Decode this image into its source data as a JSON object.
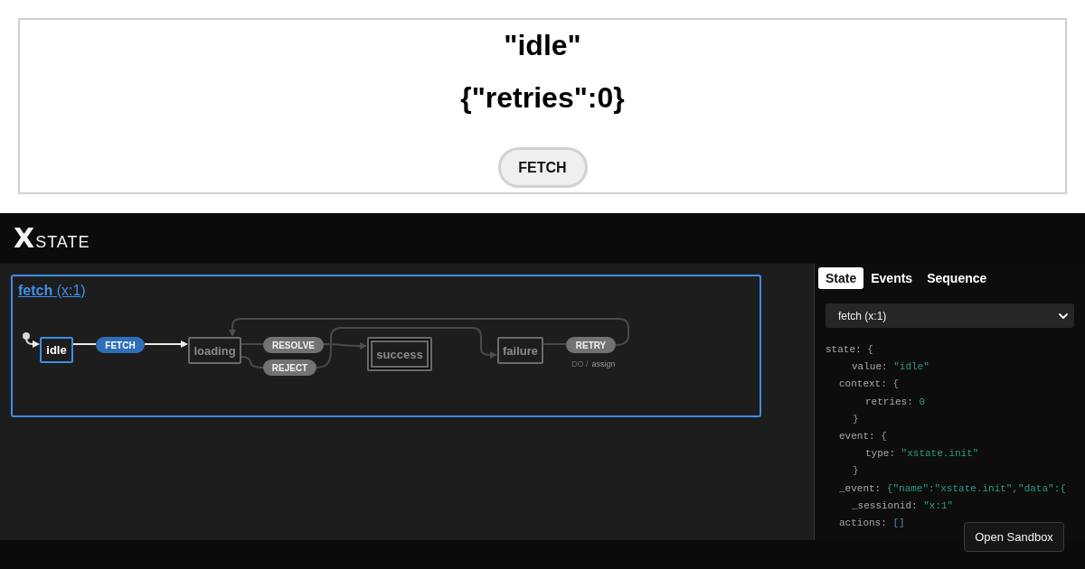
{
  "app": {
    "state_value": "\"idle\"",
    "context": "{\"retries\":0}",
    "button": "FETCH"
  },
  "inspector": {
    "logo": {
      "mark": "X",
      "word": "STATE"
    },
    "machine": {
      "title": "**fetch** (x:1)",
      "states": [
        {
          "name": "idle",
          "active": true,
          "kind": "atomic"
        },
        {
          "name": "loading",
          "active": false,
          "kind": "atomic"
        },
        {
          "name": "success",
          "active": false,
          "kind": "final"
        },
        {
          "name": "failure",
          "active": false,
          "kind": "atomic"
        }
      ],
      "transitions": [
        {
          "event": "FETCH",
          "enabled": true
        },
        {
          "event": "RESOLVE",
          "enabled": false
        },
        {
          "event": "REJECT",
          "enabled": false
        },
        {
          "event": "RETRY",
          "enabled": false,
          "actions_label": "DO /",
          "actions": [
            "assign"
          ]
        }
      ]
    },
    "tabs": [
      {
        "label": "State",
        "selected": true
      },
      {
        "label": "Events",
        "selected": false
      },
      {
        "label": "Sequence",
        "selected": false
      }
    ],
    "service_select": {
      "value": "fetch (x:1)"
    },
    "state_tree": [
      {
        "key": "state:",
        "value": "{",
        "kind": "object",
        "children": [
          {
            "key": "value:",
            "value": "\"idle\"",
            "kind": "leaf"
          },
          {
            "key": "context:",
            "value": "{",
            "kind": "object",
            "children": [
              {
                "key": "retries:",
                "value": "0",
                "kind": "leaf"
              }
            ],
            "close": "}"
          },
          {
            "key": "event:",
            "value": "{",
            "kind": "object",
            "children": [
              {
                "key": "type:",
                "value": "\"xstate.init\"",
                "kind": "leaf"
              }
            ],
            "close": "}"
          },
          {
            "key": "_event:",
            "value": "{\"name\":\"xstate.init\",\"data\":{",
            "kind": "raw"
          },
          {
            "key": "_sessionid:",
            "value": "\"x:1\"",
            "kind": "leaf"
          },
          {
            "key": "actions:",
            "value": "[]",
            "kind": "array"
          }
        ]
      }
    ],
    "open_sandbox": "Open Sandbox"
  }
}
